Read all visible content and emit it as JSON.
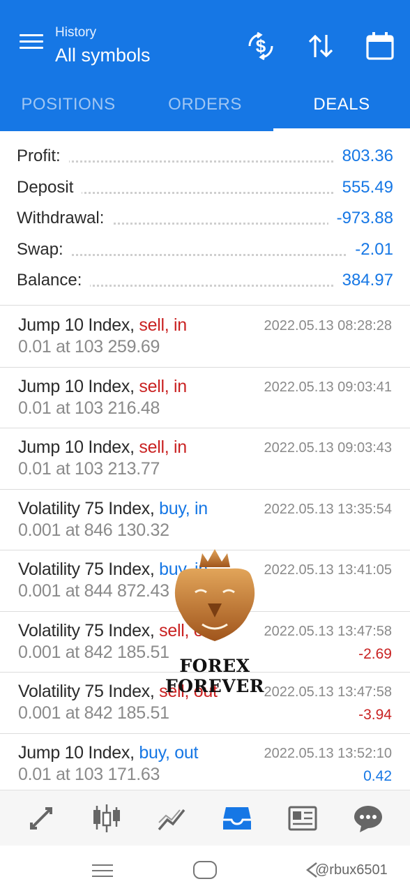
{
  "appbar": {
    "subtitle": "History",
    "title": "All symbols",
    "icons": [
      "menu-icon",
      "currency-exchange-icon",
      "sort-icon",
      "calendar-icon"
    ]
  },
  "tabs": [
    {
      "label": "POSITIONS",
      "active": false
    },
    {
      "label": "ORDERS",
      "active": false
    },
    {
      "label": "DEALS",
      "active": true
    }
  ],
  "summary": [
    {
      "label": "Profit:",
      "value": "803.36"
    },
    {
      "label": "Deposit",
      "value": "555.49"
    },
    {
      "label": "Withdrawal:",
      "value": "-973.88"
    },
    {
      "label": "Swap:",
      "value": "-2.01"
    },
    {
      "label": "Balance:",
      "value": "384.97"
    }
  ],
  "deals": [
    {
      "symbol": "Jump 10 Index,",
      "side": "sell, in",
      "side_type": "sell",
      "time": "2022.05.13 08:28:28",
      "volume": "0.01 at 103 259.69",
      "profit": ""
    },
    {
      "symbol": "Jump 10 Index,",
      "side": "sell, in",
      "side_type": "sell",
      "time": "2022.05.13 09:03:41",
      "volume": "0.01 at 103 216.48",
      "profit": ""
    },
    {
      "symbol": "Jump 10 Index,",
      "side": "sell, in",
      "side_type": "sell",
      "time": "2022.05.13 09:03:43",
      "volume": "0.01 at 103 213.77",
      "profit": ""
    },
    {
      "symbol": "Volatility 75 Index,",
      "side": "buy, in",
      "side_type": "buy",
      "time": "2022.05.13 13:35:54",
      "volume": "0.001 at 846 130.32",
      "profit": ""
    },
    {
      "symbol": "Volatility 75 Index,",
      "side": "buy, in",
      "side_type": "buy",
      "time": "2022.05.13 13:41:05",
      "volume": "0.001 at 844 872.43",
      "profit": ""
    },
    {
      "symbol": "Volatility 75 Index,",
      "side": "sell, out",
      "side_type": "sell",
      "time": "2022.05.13 13:47:58",
      "volume": "0.001 at 842 185.51",
      "profit": "-2.69"
    },
    {
      "symbol": "Volatility 75 Index,",
      "side": "sell, out",
      "side_type": "sell",
      "time": "2022.05.13 13:47:58",
      "volume": "0.001 at 842 185.51",
      "profit": "-3.94"
    },
    {
      "symbol": "Jump 10 Index,",
      "side": "buy, out",
      "side_type": "buy",
      "time": "2022.05.13 13:52:10",
      "volume": "0.01 at 103 171.63",
      "profit": "0.42"
    }
  ],
  "watermark": {
    "text": "FOREX FOREVER",
    "icon": "lion-crown-logo"
  },
  "bottom_nav": [
    {
      "icon": "quotes-arrows-icon",
      "active": false
    },
    {
      "icon": "candlestick-chart-icon",
      "active": false
    },
    {
      "icon": "trade-chart-icon",
      "active": false
    },
    {
      "icon": "history-inbox-icon",
      "active": true
    },
    {
      "icon": "news-icon",
      "active": false
    },
    {
      "icon": "chat-icon",
      "active": false
    }
  ],
  "system_nav": {
    "handle": "@rbux6501"
  },
  "colors": {
    "primary": "#1677e5",
    "sell": "#c92222",
    "buy": "#1677e5",
    "muted": "#8a8a8a"
  }
}
